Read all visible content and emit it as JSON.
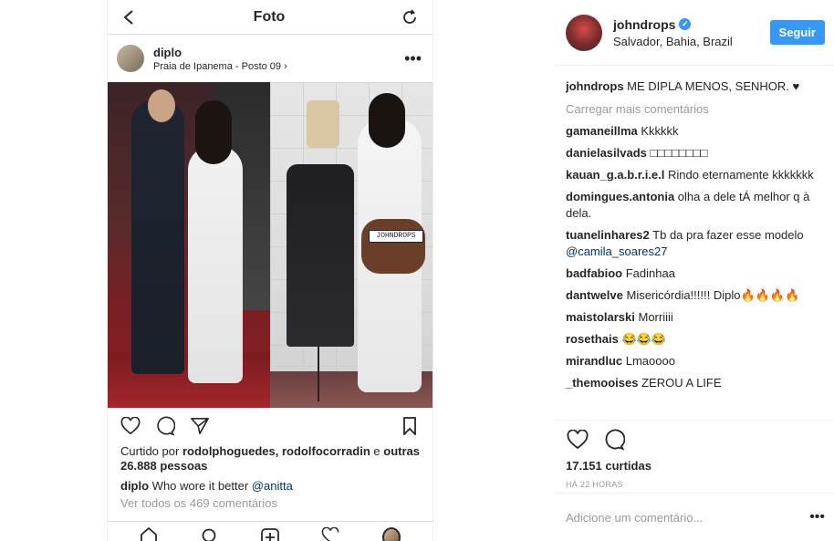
{
  "phone": {
    "title": "Foto",
    "post": {
      "username": "diplo",
      "location": "Praia de Ipanema - Posto 09",
      "location_chevron": "›",
      "more": "•••",
      "waistband_text": "JOHNDROPS",
      "liked_by_prefix": "Curtido por",
      "liked_by_users": "rodolphoguedes, rodolfocorradin",
      "liked_by_e": "e",
      "liked_by_others": "outras 26.888 pessoas",
      "caption_user": "diplo",
      "caption_text": "Who wore it better",
      "caption_mention": "@anitta",
      "view_all": "Ver todos os 469 comentários"
    },
    "icons": {
      "back": "back-arrow-icon",
      "refresh": "refresh-icon",
      "like": "heart-icon",
      "comment": "comment-icon",
      "share": "direct-share-icon",
      "save": "bookmark-icon",
      "home": "home-icon",
      "search": "search-icon",
      "new_post": "new-post-icon",
      "activity": "activity-heart-icon",
      "profile": "profile-avatar-icon"
    }
  },
  "panel": {
    "username": "johndrops",
    "verified_mark": "✓",
    "location": "Salvador, Bahia, Brazil",
    "follow_label": "Seguir",
    "caption": {
      "user": "johndrops",
      "text": "ME DIPLA MENOS, SENHOR. ♥"
    },
    "load_more": "Carregar mais comentários",
    "comments": [
      {
        "user": "gamaneillma",
        "text": "Kkkkkk"
      },
      {
        "user": "danielasilvads",
        "text": "□□□□□□□□"
      },
      {
        "user": "kauan_g.a.b.r.i.e.l",
        "text": "Rindo eternamente kkkkkkk"
      },
      {
        "user": "domingues.antonia",
        "text": "olha a dele tÁ melhor q à dela."
      },
      {
        "user": "tuanelinhares2",
        "text": "Tb da pra fazer esse modelo",
        "mention": "@camila_soares27"
      },
      {
        "user": "badfabioo",
        "text": "Fadinhaa"
      },
      {
        "user": "dantwelve",
        "text": "Misericórdia!!!!!! Diplo🔥🔥🔥🔥"
      },
      {
        "user": "maistolarski",
        "text": "Morriiii"
      },
      {
        "user": "rosethais",
        "text": "😂😂😂"
      },
      {
        "user": "mirandluc",
        "text": "Lmaoooo"
      },
      {
        "user": "_themooises",
        "text": "ZEROU A LIFE"
      }
    ],
    "likes": "17.151 curtidas",
    "timestamp": "HÁ 22 HORAS",
    "add_comment_placeholder": "Adicione um comentário...",
    "more": "•••"
  },
  "colors": {
    "accent": "#3897f0",
    "text": "#262626",
    "muted": "#999999",
    "mention": "#003569"
  }
}
